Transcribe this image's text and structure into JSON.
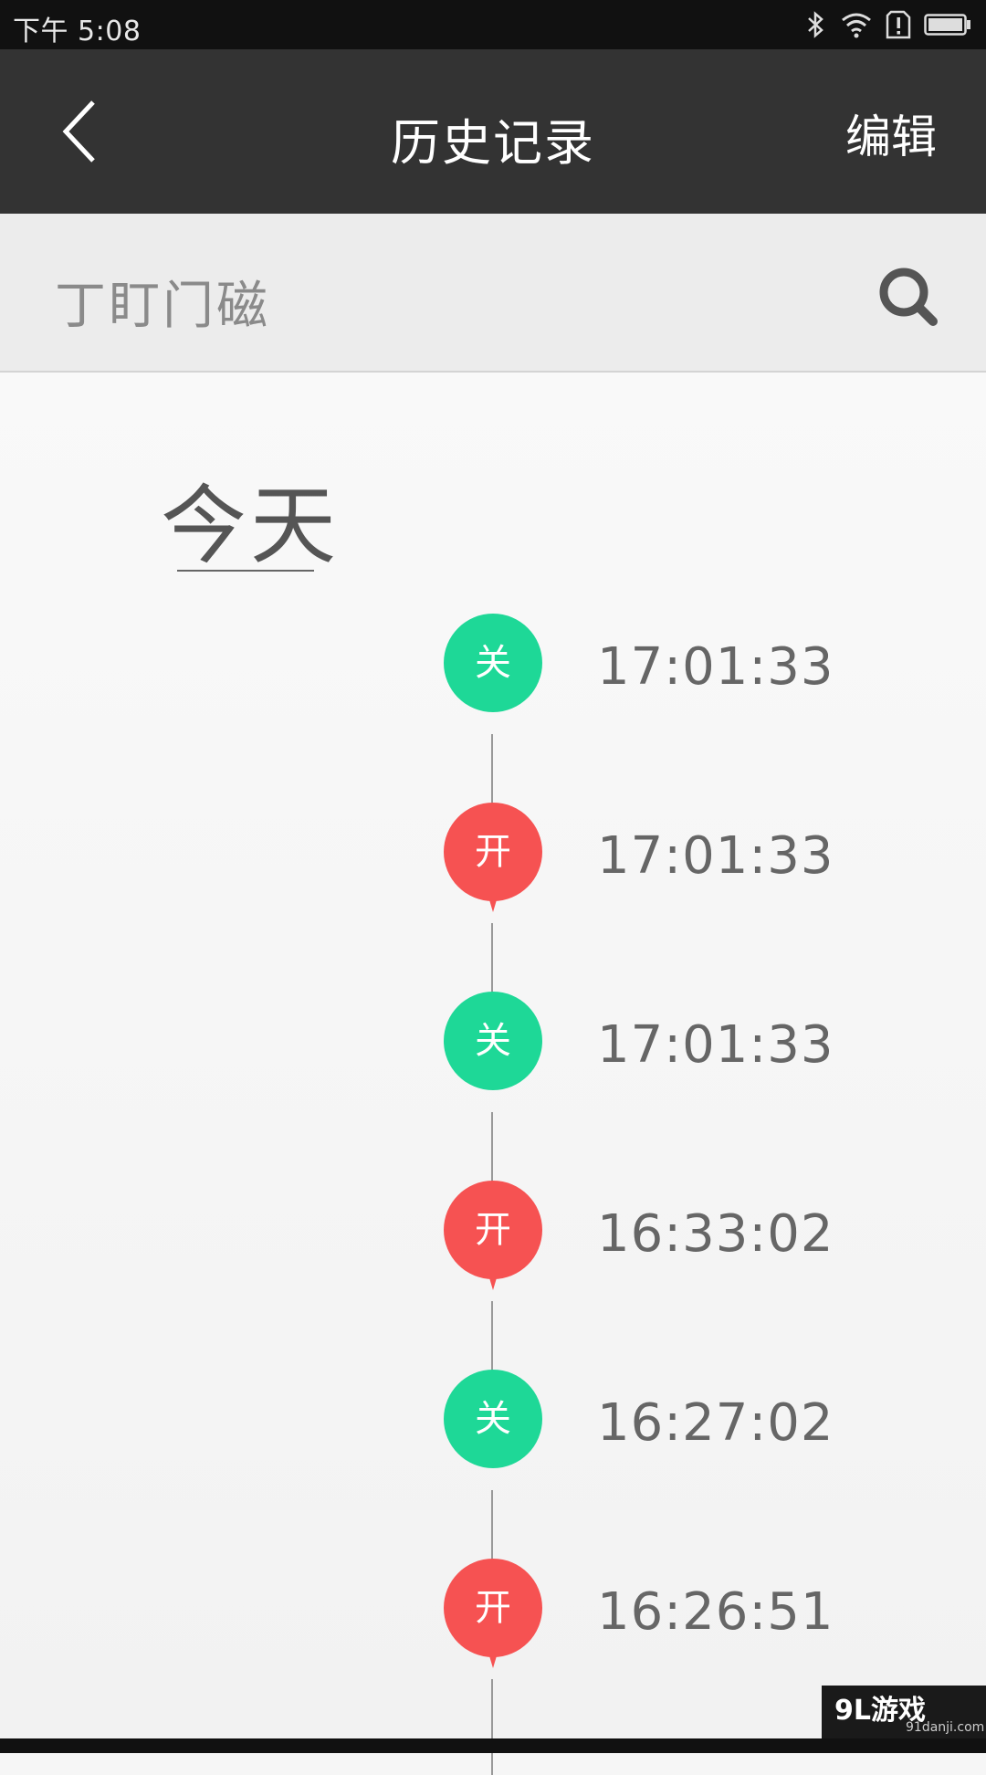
{
  "status_bar": {
    "time": "下午 5:08",
    "icons": [
      "bluetooth-icon",
      "wifi-icon",
      "alert-sim-icon",
      "battery-icon"
    ]
  },
  "header": {
    "back_icon": "chevron-left-icon",
    "title": "历史记录",
    "edit_label": "编辑"
  },
  "search": {
    "value": "丁盯门磁",
    "icon": "search-icon"
  },
  "history": {
    "day_label": "今天",
    "records": [
      {
        "status": "关",
        "type": "close",
        "time": "17:01:33"
      },
      {
        "status": "开",
        "type": "open",
        "time": "17:01:33"
      },
      {
        "status": "关",
        "type": "close",
        "time": "17:01:33"
      },
      {
        "status": "开",
        "type": "open",
        "time": "16:33:02"
      },
      {
        "status": "关",
        "type": "close",
        "time": "16:27:02"
      },
      {
        "status": "开",
        "type": "open",
        "time": "16:26:51"
      }
    ]
  },
  "colors": {
    "header_bg": "#333333",
    "close_green": "#1ed897",
    "open_red": "#f65252"
  },
  "watermark": {
    "main": "9L游戏",
    "sub": "91danji.com"
  }
}
